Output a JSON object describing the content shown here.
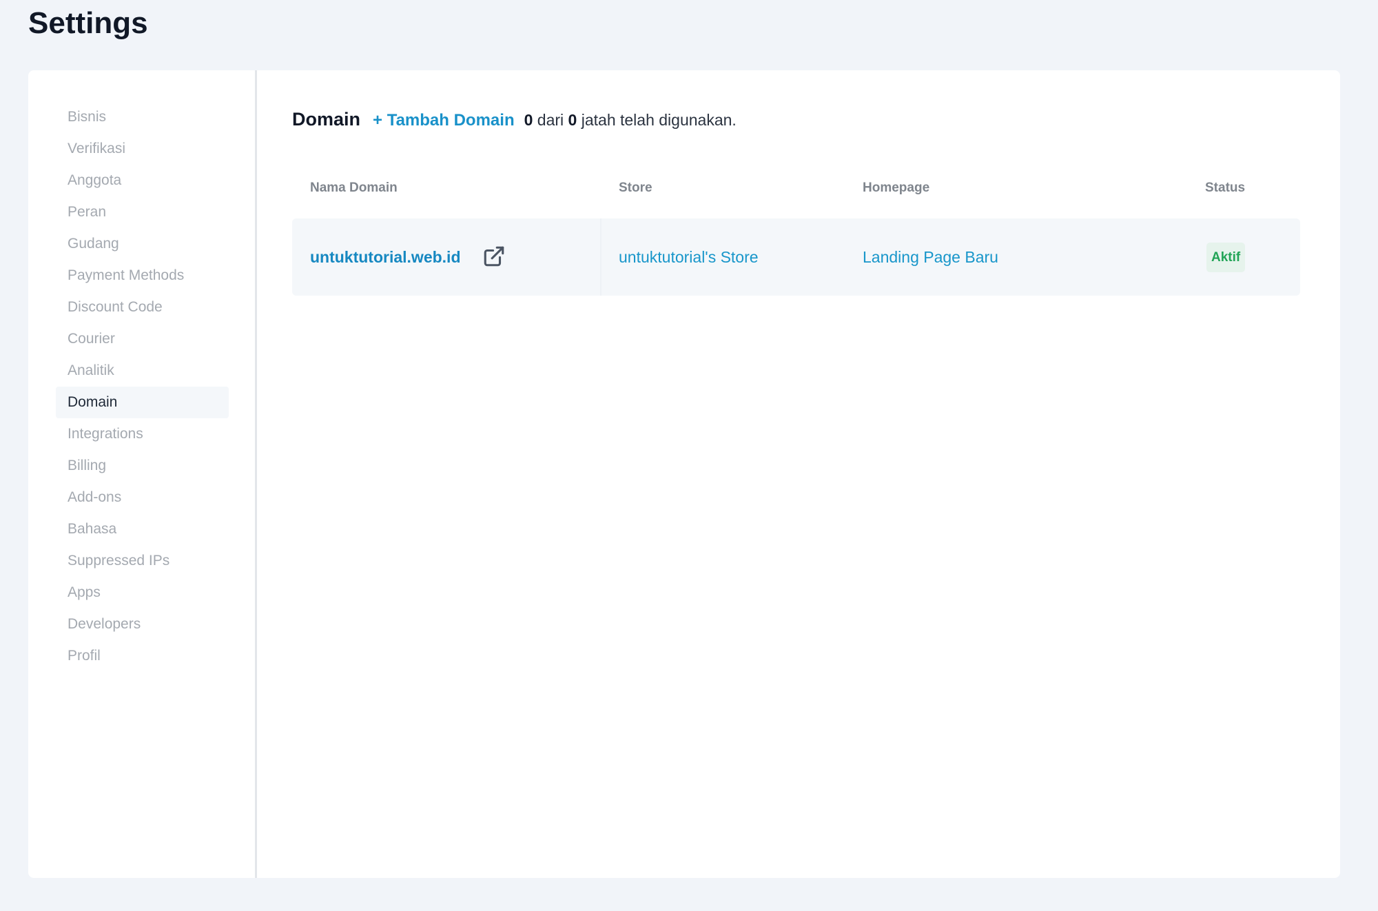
{
  "page": {
    "title": "Settings"
  },
  "sidebar": {
    "items": [
      {
        "label": "Bisnis"
      },
      {
        "label": "Verifikasi"
      },
      {
        "label": "Anggota"
      },
      {
        "label": "Peran"
      },
      {
        "label": "Gudang"
      },
      {
        "label": "Payment Methods"
      },
      {
        "label": "Discount Code"
      },
      {
        "label": "Courier"
      },
      {
        "label": "Analitik"
      },
      {
        "label": "Domain",
        "active": true
      },
      {
        "label": "Integrations"
      },
      {
        "label": "Billing"
      },
      {
        "label": "Add-ons"
      },
      {
        "label": "Bahasa"
      },
      {
        "label": "Suppressed IPs"
      },
      {
        "label": "Apps"
      },
      {
        "label": "Developers"
      },
      {
        "label": "Profil"
      }
    ]
  },
  "domain": {
    "title": "Domain",
    "add_label": "+ Tambah Domain",
    "quota": {
      "used": "0",
      "sep": "dari",
      "total": "0",
      "suffix": "jatah telah digunakan."
    },
    "columns": {
      "name": "Nama Domain",
      "store": "Store",
      "homepage": "Homepage",
      "status": "Status"
    },
    "rows": [
      {
        "name": "untuktutorial.web.id",
        "open_icon": "external-link-icon",
        "store": "untuktutorial's Store",
        "homepage": "Landing Page Baru",
        "status": "Aktif"
      }
    ]
  },
  "colors": {
    "accent": "#1991c9",
    "status_active_text": "#21a456",
    "status_active_bg": "#e6f3ec",
    "page_bg": "#f1f4f9"
  }
}
